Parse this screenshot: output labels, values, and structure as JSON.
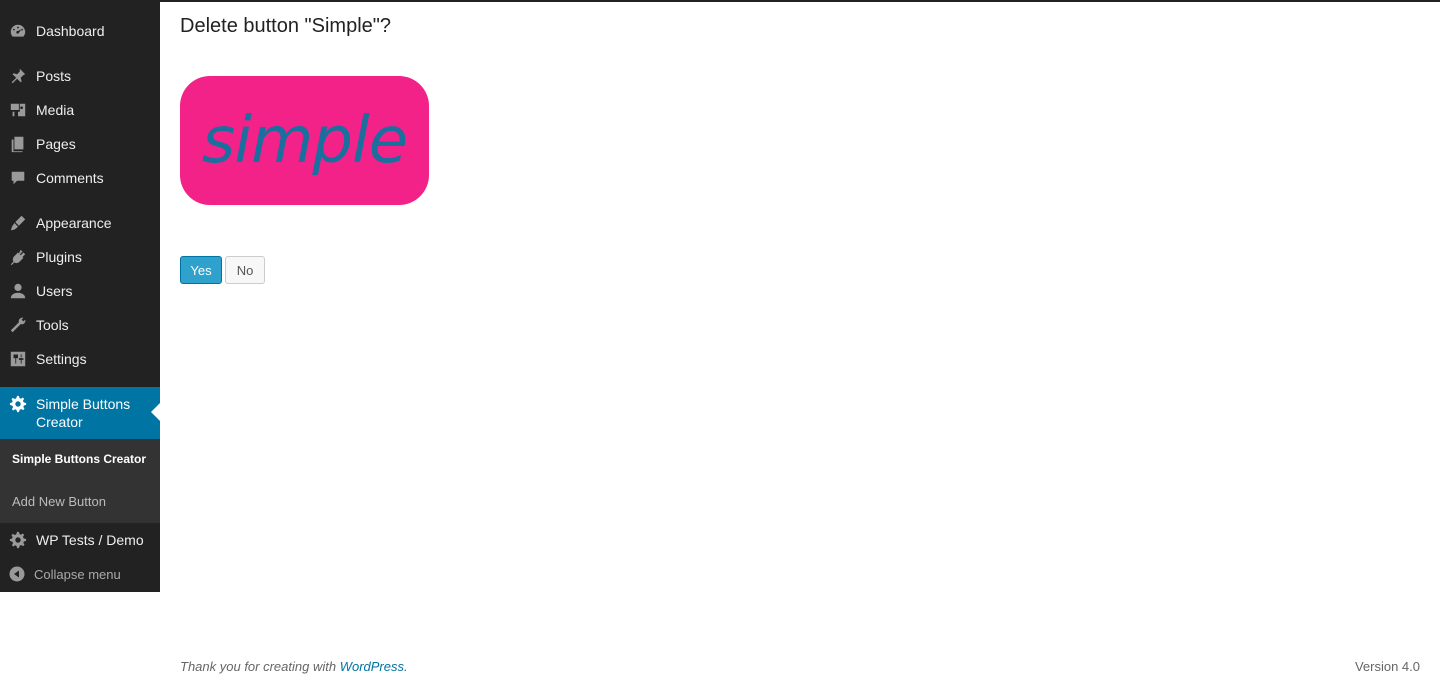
{
  "sidebar": {
    "items": [
      {
        "label": "Dashboard",
        "icon": "dashboard-icon"
      },
      {
        "label": "Posts",
        "icon": "pin-icon"
      },
      {
        "label": "Media",
        "icon": "media-icon"
      },
      {
        "label": "Pages",
        "icon": "pages-icon"
      },
      {
        "label": "Comments",
        "icon": "comment-icon"
      },
      {
        "label": "Appearance",
        "icon": "brush-icon"
      },
      {
        "label": "Plugins",
        "icon": "plug-icon"
      },
      {
        "label": "Users",
        "icon": "user-icon"
      },
      {
        "label": "Tools",
        "icon": "wrench-icon"
      },
      {
        "label": "Settings",
        "icon": "settings-sliders-icon"
      }
    ],
    "active": {
      "label": "Simple Buttons Creator",
      "icon": "gear-icon"
    },
    "submenu": {
      "current": "Simple Buttons Creator",
      "add_new": "Add New Button"
    },
    "wp_tests": {
      "label": "WP Tests / Demo",
      "icon": "gear-icon"
    },
    "collapse": {
      "label": "Collapse menu",
      "icon": "collapse-arrow-icon"
    }
  },
  "main": {
    "title": "Delete button \"Simple\"?",
    "preview_text": "simple",
    "preview_bg": "#f32289",
    "preview_text_color": "#1a6f9e",
    "yes_label": "Yes",
    "no_label": "No"
  },
  "footer": {
    "thanks": "Thank you for creating with",
    "link": "WordPress",
    "dot": ".",
    "version": "Version 4.0"
  },
  "colors": {
    "sidebar_bg": "#222222",
    "accent": "#0074a2",
    "submenu_bg": "#333333"
  }
}
